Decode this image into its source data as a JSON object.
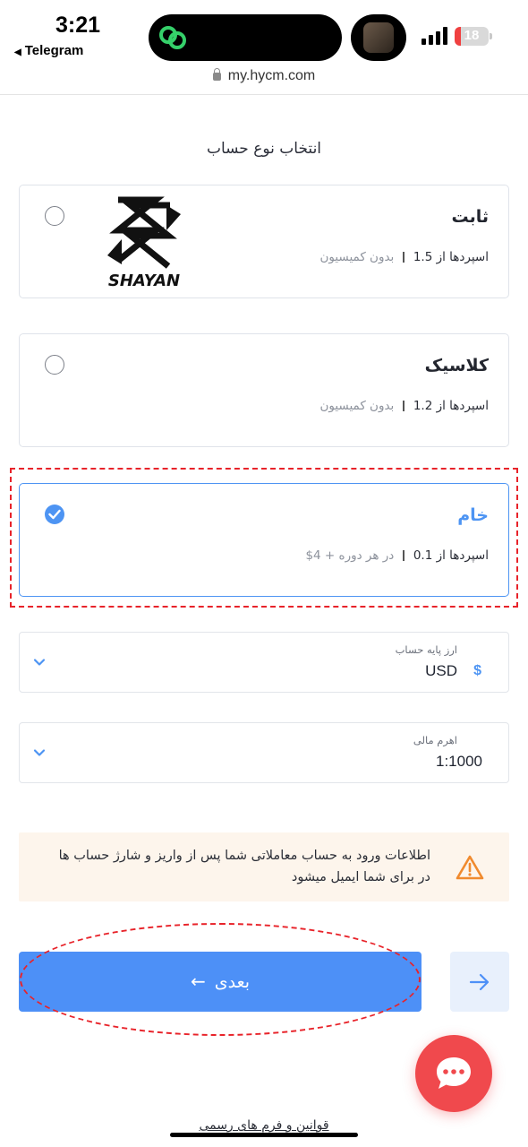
{
  "status_bar": {
    "time": "3:21",
    "back_app": "Telegram",
    "battery_level": "18",
    "battery_fill_fraction": 0.18
  },
  "browser": {
    "url": "my.hycm.com"
  },
  "page": {
    "title": "انتخاب نوع حساب"
  },
  "account_types": [
    {
      "name": "ثابت",
      "spread": "اسپردها از 1.5",
      "extra": "بدون کمیسیون",
      "selected": false
    },
    {
      "name": "کلاسیک",
      "spread": "اسپردها از 1.2",
      "extra": "بدون کمیسیون",
      "selected": false
    },
    {
      "name": "خام",
      "spread": "اسپردها از 0.1",
      "extra": "در هر دوره + 4$",
      "selected": true
    }
  ],
  "logo": {
    "text": "SHAYAN"
  },
  "base_currency": {
    "label": "ارز پایه حساب",
    "value": "USD",
    "icon": "$"
  },
  "leverage": {
    "label": "اهرم مالی",
    "value": "1:1000"
  },
  "notice": {
    "text": "اطلاعات ورود به حساب معاملاتی شما پس از واریز و شارژ حساب ها در برای شما ایمیل میشود"
  },
  "buttons": {
    "next_label": "بعدی",
    "next_arrow": "←"
  },
  "footer": {
    "link": "قوانین و فرم های رسمی"
  },
  "colors": {
    "accent": "#4d94f3",
    "annotation": "#e8232a",
    "chat": "#f0494d",
    "notice_bg": "#fdf5ec",
    "warning": "#f08a2e"
  }
}
